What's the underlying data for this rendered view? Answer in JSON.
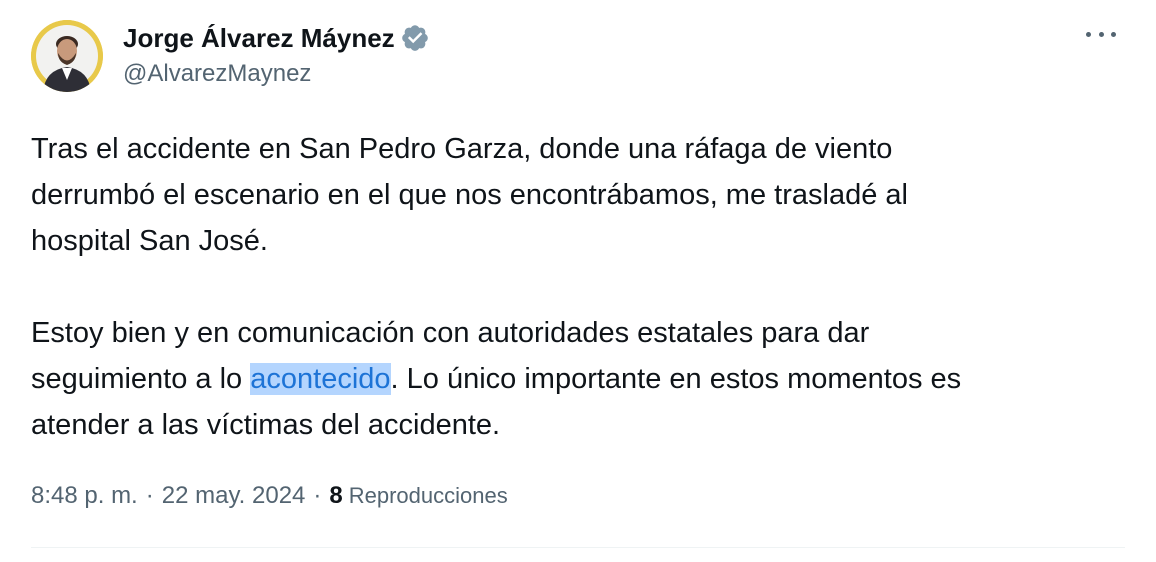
{
  "author": {
    "display_name": "Jorge Álvarez Máynez",
    "handle": "@AlvarezMaynez",
    "verified": true,
    "verified_badge_color": "#829aab",
    "avatar_bg": "#e8c94a"
  },
  "tweet": {
    "paragraph1_lines": [
      "Tras el accidente en San Pedro Garza, donde una ráfaga de viento",
      "derrumbó el escenario en el que nos encontrábamos, me trasladé al",
      "hospital San José."
    ],
    "paragraph2_line1": "Estoy bien y en comunicación con autoridades estatales para dar",
    "paragraph2_line2_before": "seguimiento a lo ",
    "paragraph2_line2_highlight": "acontecido",
    "paragraph2_line2_after": ". Lo único importante en estos momentos es",
    "paragraph2_line3": "atender a las víctimas del accidente.",
    "highlight_color": "#b4d5fe"
  },
  "meta": {
    "time": "8:48 p. m.",
    "separator": "·",
    "date": "22 may. 2024",
    "views_count": "8",
    "views_label": "Reproducciones"
  },
  "icons": {
    "more": "more-options-icon",
    "verified": "verified-badge-icon"
  }
}
